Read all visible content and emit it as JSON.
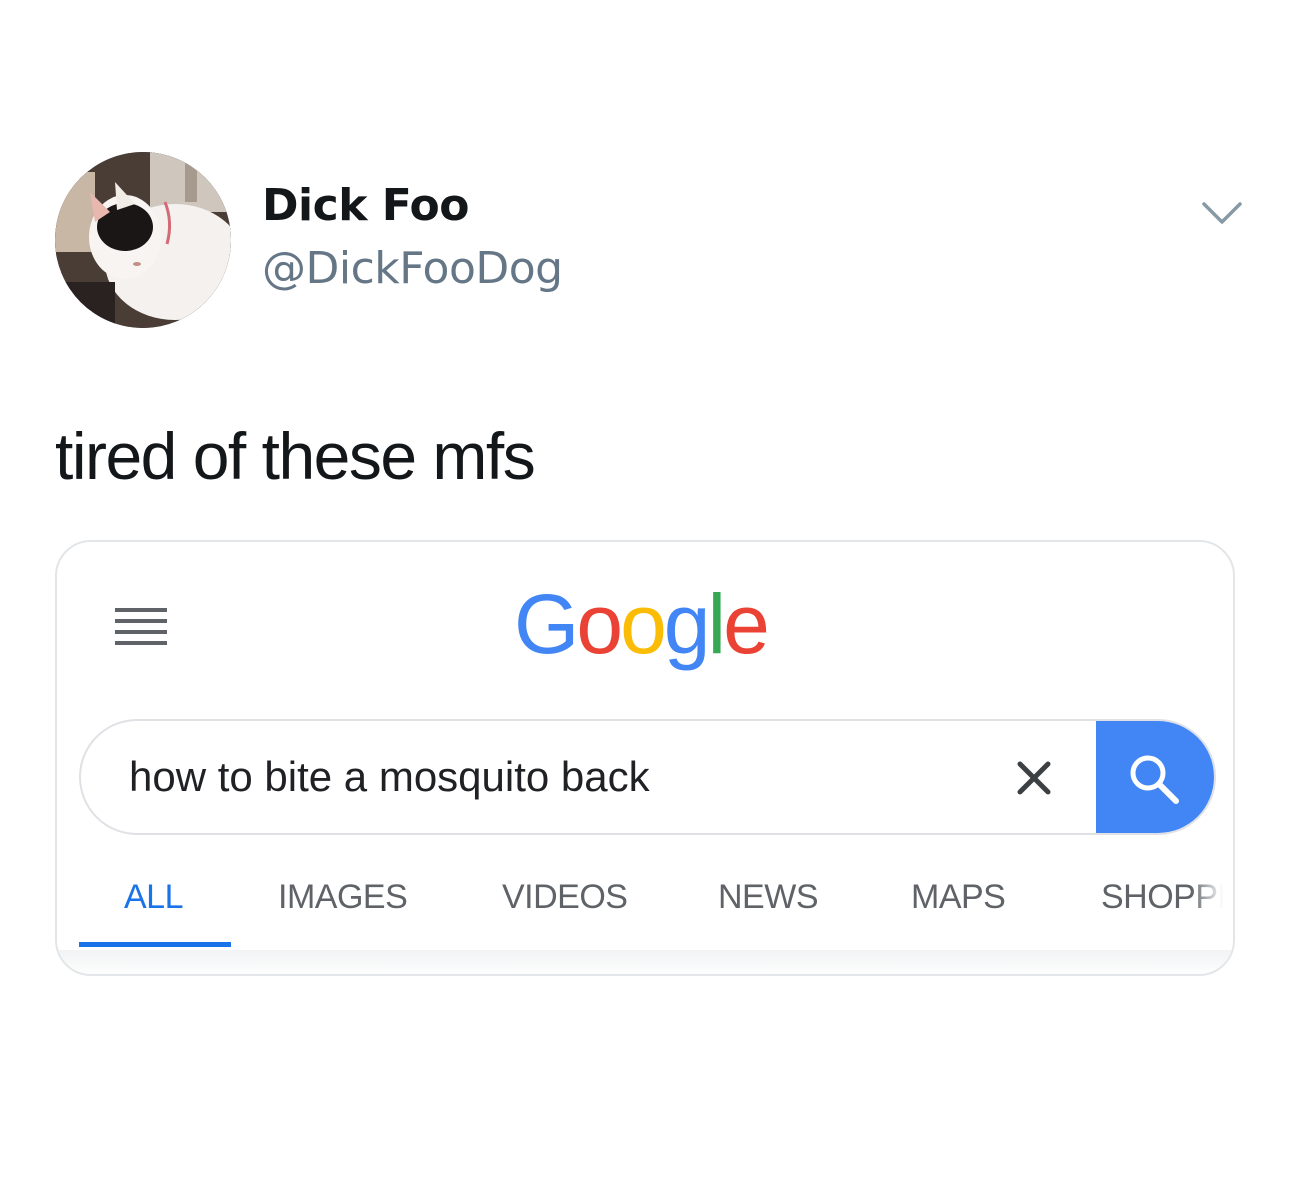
{
  "tweet": {
    "display_name": "Dick Foo",
    "handle": "@DickFooDog",
    "text": "tired of these mfs"
  },
  "google": {
    "logo_letters": [
      {
        "char": "G",
        "color": "#4285f4"
      },
      {
        "char": "o",
        "color": "#ea4335"
      },
      {
        "char": "o",
        "color": "#fbbc05"
      },
      {
        "char": "g",
        "color": "#4285f4"
      },
      {
        "char": "l",
        "color": "#34a853"
      },
      {
        "char": "e",
        "color": "#ea4335"
      }
    ],
    "search": {
      "query": "how to bite a mosquito back"
    },
    "tabs": [
      {
        "label": "ALL",
        "active": true
      },
      {
        "label": "IMAGES",
        "active": false
      },
      {
        "label": "VIDEOS",
        "active": false
      },
      {
        "label": "NEWS",
        "active": false
      },
      {
        "label": "MAPS",
        "active": false
      },
      {
        "label": "SHOPPI",
        "active": false
      }
    ]
  },
  "icons": {
    "caret": "chevron-down-icon",
    "menu": "hamburger-menu-icon",
    "clear": "close-icon",
    "search": "search-icon"
  },
  "colors": {
    "accent_blue": "#4285f4",
    "active_tab": "#1a73e8",
    "handle_gray": "#657786"
  }
}
